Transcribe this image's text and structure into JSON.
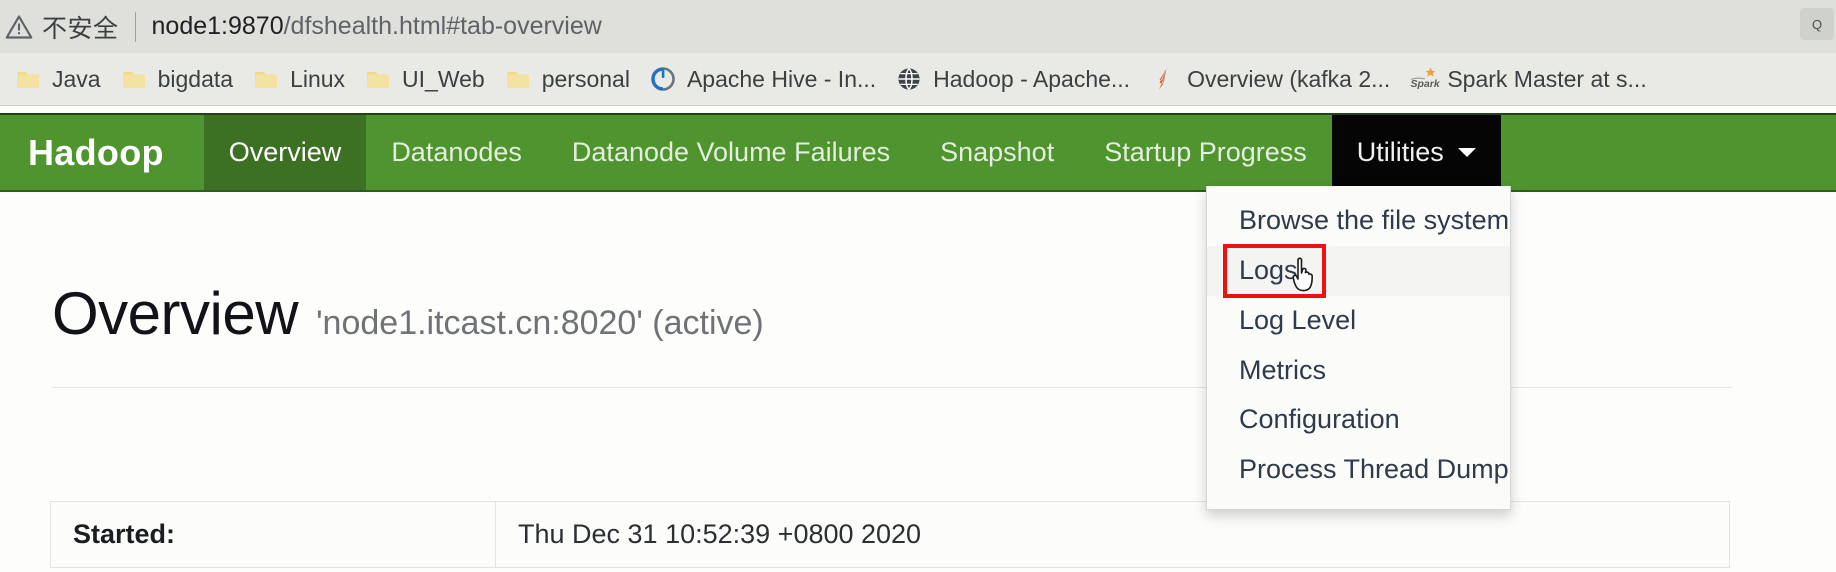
{
  "browser": {
    "security_label": "不安全",
    "url_host": "node1:9870",
    "url_path": "/dfshealth.html#tab-overview",
    "zoom_badge": "Q",
    "bookmarks": [
      {
        "label": "Java",
        "icon": "folder-icon"
      },
      {
        "label": "bigdata",
        "icon": "folder-icon"
      },
      {
        "label": "Linux",
        "icon": "folder-icon"
      },
      {
        "label": "UI_Web",
        "icon": "folder-icon"
      },
      {
        "label": "personal",
        "icon": "folder-icon"
      },
      {
        "label": "Apache Hive - In...",
        "icon": "hive-icon"
      },
      {
        "label": "Hadoop - Apache...",
        "icon": "globe-icon"
      },
      {
        "label": "Overview (kafka 2...",
        "icon": "kafka-icon"
      },
      {
        "label": "Spark Master at s...",
        "icon": "spark-icon"
      }
    ]
  },
  "navbar": {
    "brand": "Hadoop",
    "items": [
      {
        "label": "Overview",
        "state": "active"
      },
      {
        "label": "Datanodes",
        "state": "default"
      },
      {
        "label": "Datanode Volume Failures",
        "state": "default"
      },
      {
        "label": "Snapshot",
        "state": "default"
      },
      {
        "label": "Startup Progress",
        "state": "default"
      },
      {
        "label": "Utilities",
        "state": "open",
        "caret": true
      }
    ],
    "bg_color": "#4f942f",
    "active_color": "#3c7023",
    "open_color": "#050505"
  },
  "dropdown": {
    "items": [
      {
        "label": "Browse the file system",
        "hovered": false
      },
      {
        "label": "Logs",
        "hovered": true
      },
      {
        "label": "Log Level",
        "hovered": false
      },
      {
        "label": "Metrics",
        "hovered": false
      },
      {
        "label": "Configuration",
        "hovered": false
      },
      {
        "label": "Process Thread Dump",
        "hovered": false
      }
    ],
    "highlight_color": "#ee1111",
    "highlighted_item": "Logs"
  },
  "page": {
    "heading_main": "Overview",
    "heading_sub": "'node1.itcast.cn:8020' (active)",
    "table": {
      "rows": [
        {
          "key": "Started:",
          "value": "Thu Dec 31 10:52:39 +0800 2020"
        }
      ]
    }
  }
}
